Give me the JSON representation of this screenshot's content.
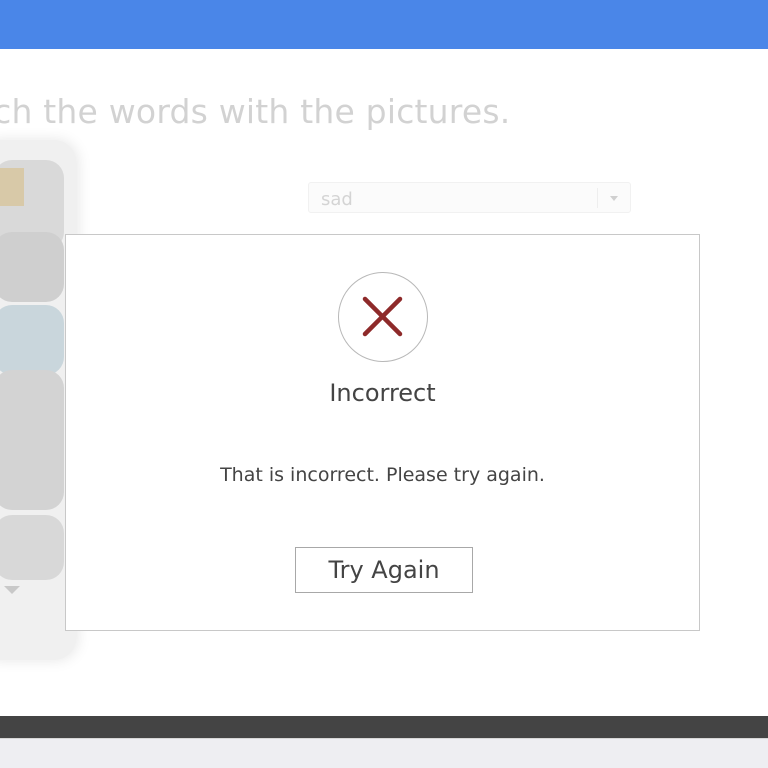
{
  "page": {
    "instruction": "tch the words with the pictures."
  },
  "dropdown": {
    "selected_value": "sad"
  },
  "dialog": {
    "status_icon": "x-icon",
    "title": "Incorrect",
    "message": "That is incorrect. Please try again.",
    "button_label": "Try Again"
  },
  "colors": {
    "header_blue": "#4a86e8",
    "error_red": "#8e2a2a",
    "footer_dark": "#444444"
  }
}
